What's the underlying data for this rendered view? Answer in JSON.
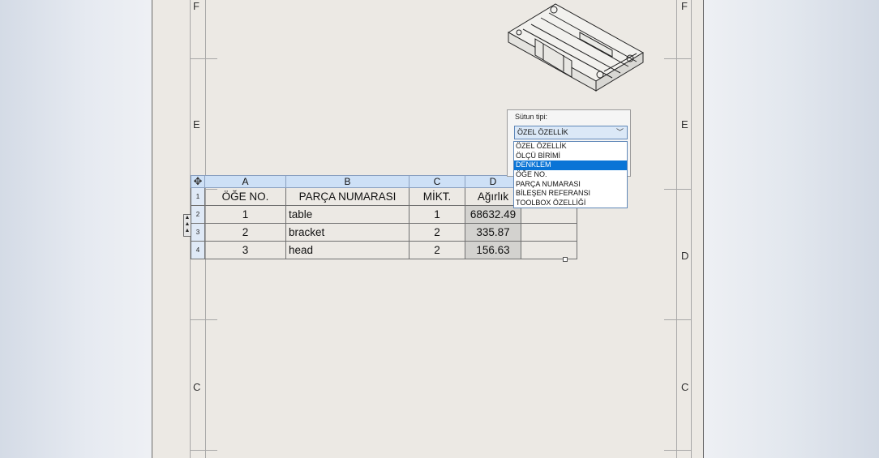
{
  "sheet": {
    "zones_left": [
      "F",
      "E",
      "C"
    ],
    "zones_right": [
      "F",
      "E",
      "D",
      "C"
    ]
  },
  "table": {
    "columns": [
      "A",
      "B",
      "C",
      "D"
    ],
    "row_numbers": [
      "1",
      "2",
      "3",
      "4"
    ],
    "headers": [
      "ÖĞE NO.",
      "PARÇA NUMARASI",
      "MİKT.",
      "Ağırlık"
    ],
    "rows": [
      {
        "item": "1",
        "part": "table",
        "qty": "1",
        "weight": "68632.49"
      },
      {
        "item": "2",
        "part": "bracket",
        "qty": "2",
        "weight": "335.87"
      },
      {
        "item": "3",
        "part": "head",
        "qty": "2",
        "weight": "156.63"
      }
    ]
  },
  "popup": {
    "label": "Sütun tipi:",
    "selected": "ÖZEL ÖZELLİK",
    "options": [
      "ÖZEL ÖZELLİK",
      "ÖLÇÜ BİRİMİ",
      "DENKLEM",
      "ÖĞE NO.",
      "PARÇA NUMARASI",
      "BİLEŞEN REFERANSI",
      "TOOLBOX ÖZELLİĞİ"
    ],
    "highlighted_index": 2
  },
  "icons": {
    "move": "move-icon",
    "dropdown": "chevron-down-icon"
  }
}
